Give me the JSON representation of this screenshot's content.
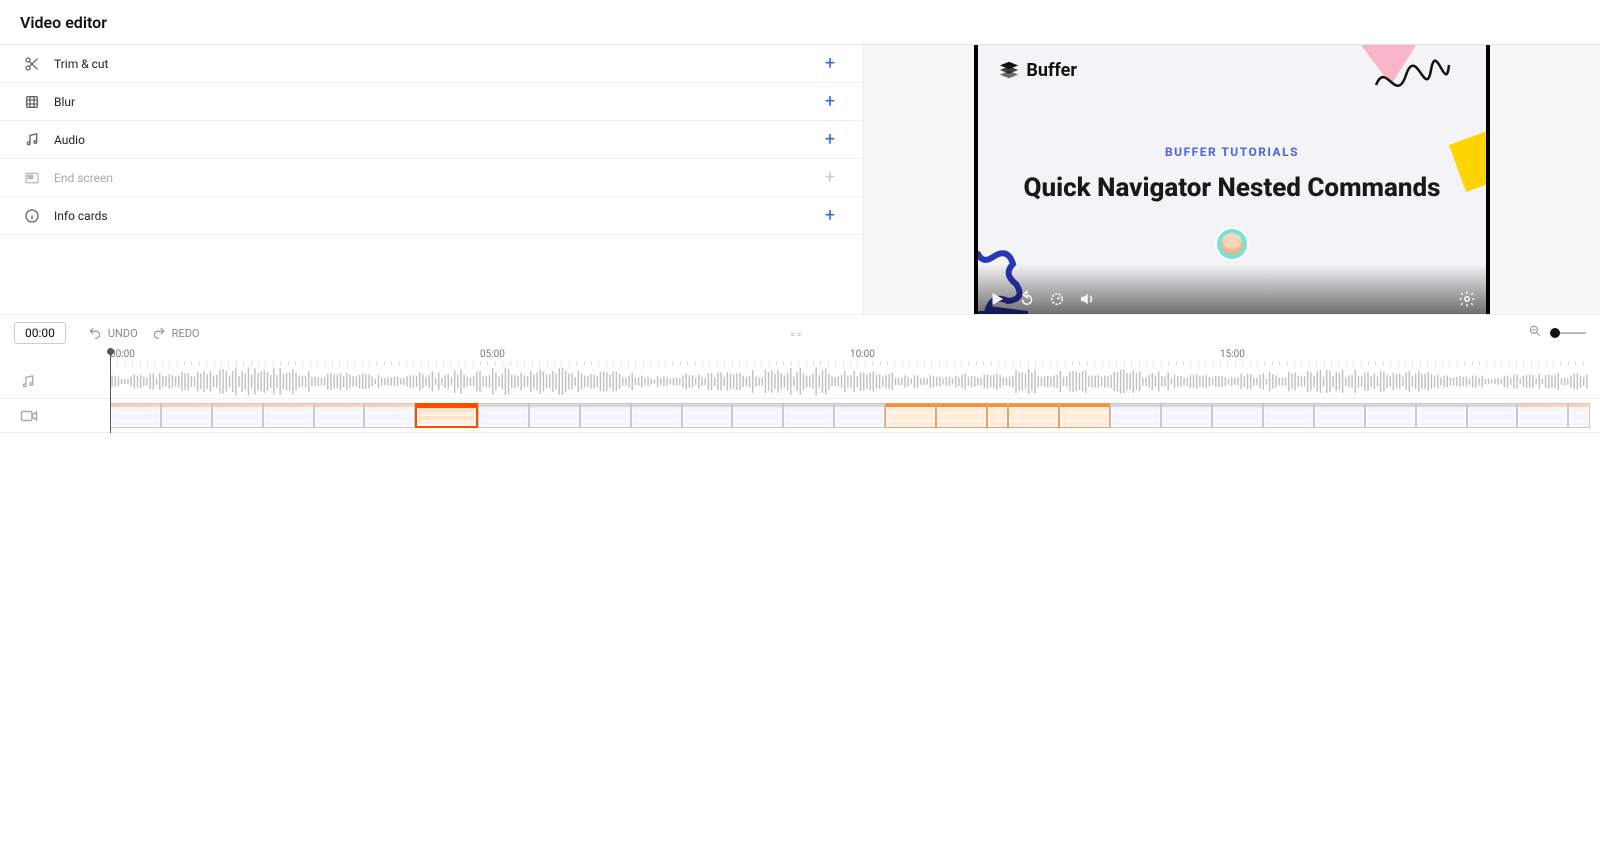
{
  "page_title": "Video editor",
  "tools": [
    {
      "id": "trim",
      "label": "Trim & cut",
      "icon": "scissors-icon",
      "enabled": true
    },
    {
      "id": "blur",
      "label": "Blur",
      "icon": "blur-icon",
      "enabled": true
    },
    {
      "id": "audio",
      "label": "Audio",
      "icon": "music-icon",
      "enabled": true
    },
    {
      "id": "end",
      "label": "End screen",
      "icon": "endscreen-icon",
      "enabled": false
    },
    {
      "id": "info",
      "label": "Info cards",
      "icon": "info-icon",
      "enabled": true
    }
  ],
  "preview": {
    "brand_name": "Buffer",
    "subtitle_pre": "BUFFER TUTORIALS",
    "subtitle_main": "Quick Navigator Nested Commands"
  },
  "timeline_toolbar": {
    "current_time": "00:00",
    "undo_label": "UNDO",
    "redo_label": "REDO"
  },
  "ruler_ticks": [
    "00:00",
    "05:00",
    "10:00",
    "15:00"
  ],
  "clip_styles": [
    "light",
    "light",
    "light",
    "light",
    "light",
    "light",
    "sel",
    "ui",
    "ui",
    "ui",
    "ui",
    "ui",
    "ui",
    "ui",
    "ui",
    "warm",
    "warm",
    "thin warm",
    "warm",
    "warm",
    "ui",
    "ui",
    "ui",
    "ui",
    "ui",
    "ui",
    "ui",
    "ui",
    "light",
    "thin light"
  ]
}
